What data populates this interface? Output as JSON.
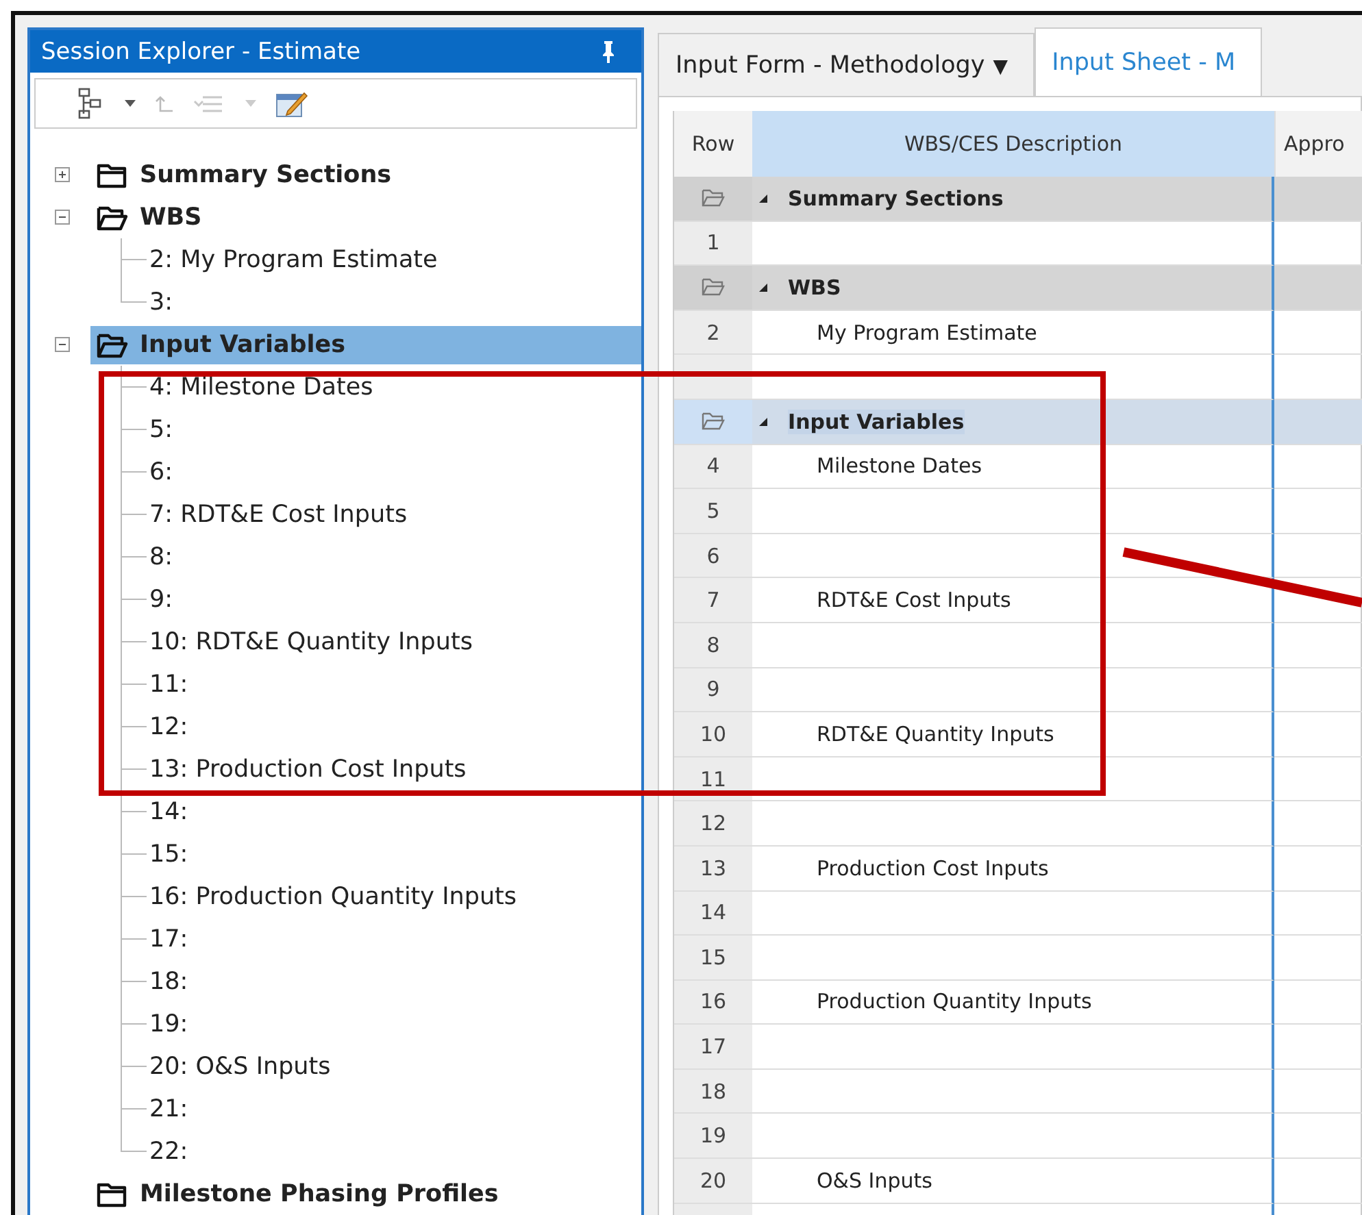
{
  "explorer": {
    "title": "Session Explorer - Estimate",
    "tree": [
      {
        "label": "Summary Sections",
        "expanded": false,
        "selected": false
      },
      {
        "label": "WBS",
        "expanded": true,
        "selected": false,
        "children": [
          {
            "label": "2: My Program Estimate",
            "selected": false
          },
          {
            "label": "3:",
            "selected": false
          }
        ]
      },
      {
        "label": "Input Variables",
        "expanded": true,
        "selected": true,
        "children": [
          {
            "label": "4: Milestone Dates",
            "selected": false
          },
          {
            "label": "5:",
            "selected": false
          },
          {
            "label": "6:",
            "selected": false
          },
          {
            "label": "7: RDT&E Cost Inputs",
            "selected": false
          },
          {
            "label": "8:",
            "selected": false
          },
          {
            "label": "9:",
            "selected": false
          },
          {
            "label": "10: RDT&E Quantity Inputs",
            "selected": false
          },
          {
            "label": "11:",
            "selected": false
          },
          {
            "label": "12:",
            "selected": false
          },
          {
            "label": "13: Production Cost Inputs",
            "selected": false
          },
          {
            "label": "14:",
            "selected": false
          },
          {
            "label": "15:",
            "selected": false
          },
          {
            "label": "16: Production Quantity Inputs",
            "selected": false
          },
          {
            "label": "17:",
            "selected": false
          },
          {
            "label": "18:",
            "selected": false
          },
          {
            "label": "19:",
            "selected": false
          },
          {
            "label": "20: O&S Inputs",
            "selected": false
          },
          {
            "label": "21:",
            "selected": false
          },
          {
            "label": "22:",
            "selected": false
          }
        ]
      },
      {
        "label": "Milestone Phasing Profiles",
        "selected": false
      }
    ]
  },
  "tabs": [
    {
      "label": "Input Form - Methodology",
      "caret": "▼",
      "selected": false
    },
    {
      "label": "Input Sheet - M",
      "selected": true
    }
  ],
  "table": {
    "columns": [
      {
        "label": "Row",
        "selected": false
      },
      {
        "label": "WBS/CES Description",
        "selected": true
      },
      {
        "label": "Appro",
        "selected": false
      }
    ],
    "rows": [
      {
        "kind": "group",
        "description": "Summary Sections",
        "selected": false
      },
      {
        "kind": "item",
        "row": "1",
        "selected": false
      },
      {
        "kind": "group",
        "description": "WBS",
        "selected": false
      },
      {
        "kind": "item",
        "row": "2",
        "description": "My Program Estimate",
        "selected": false
      },
      {
        "kind": "item",
        "selected": false
      },
      {
        "kind": "group",
        "description": "Input Variables",
        "selected": true
      },
      {
        "kind": "item",
        "row": "4",
        "description": "Milestone Dates",
        "selected": false
      },
      {
        "kind": "item",
        "row": "5",
        "selected": false
      },
      {
        "kind": "item",
        "row": "6",
        "selected": false
      },
      {
        "kind": "item",
        "row": "7",
        "description": "RDT&E Cost Inputs",
        "selected": false
      },
      {
        "kind": "item",
        "row": "8",
        "selected": false
      },
      {
        "kind": "item",
        "row": "9",
        "selected": false
      },
      {
        "kind": "item",
        "row": "10",
        "description": "RDT&E Quantity Inputs",
        "selected": false
      },
      {
        "kind": "item",
        "row": "11",
        "selected": false
      },
      {
        "kind": "item",
        "row": "12",
        "selected": false
      },
      {
        "kind": "item",
        "row": "13",
        "description": "Production Cost Inputs",
        "selected": false
      },
      {
        "kind": "item",
        "row": "14",
        "selected": false
      },
      {
        "kind": "item",
        "row": "15",
        "selected": false
      },
      {
        "kind": "item",
        "row": "16",
        "description": "Production Quantity Inputs",
        "selected": false
      },
      {
        "kind": "item",
        "row": "17",
        "selected": false
      },
      {
        "kind": "item",
        "row": "18",
        "selected": false
      },
      {
        "kind": "item",
        "row": "19",
        "selected": false
      },
      {
        "kind": "item",
        "row": "20",
        "description": "O&S Inputs",
        "selected": false
      }
    ]
  }
}
